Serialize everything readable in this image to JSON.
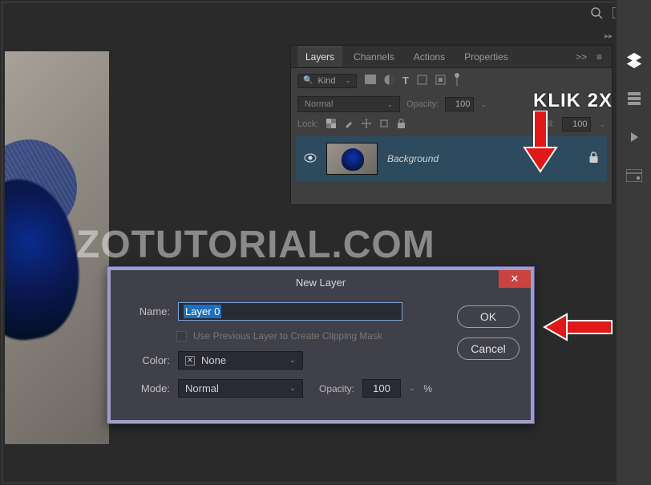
{
  "topbar": {
    "search_tip": "Search",
    "workspace_tip": "Workspace Switcher"
  },
  "panel": {
    "tabs": [
      "Layers",
      "Channels",
      "Actions",
      "Properties"
    ],
    "filter_label": "Kind",
    "blend_mode": "Normal",
    "opacity_label": "Opacity:",
    "opacity_value": "100",
    "lock_label": "Lock:",
    "fill_label": "Fill:",
    "fill_value": "100",
    "layer": {
      "name": "Background"
    }
  },
  "annotation": {
    "klik2x": "KLIK 2X"
  },
  "watermark": "ZOTUTORIAL.COM",
  "dialog": {
    "title": "New Layer",
    "name_label": "Name:",
    "name_value": "Layer 0",
    "clip_label": "Use Previous Layer to Create Clipping Mask",
    "color_label": "Color:",
    "color_value": "None",
    "mode_label": "Mode:",
    "mode_value": "Normal",
    "opacity_label": "Opacity:",
    "opacity_value": "100",
    "percent": "%",
    "ok": "OK",
    "cancel": "Cancel"
  }
}
